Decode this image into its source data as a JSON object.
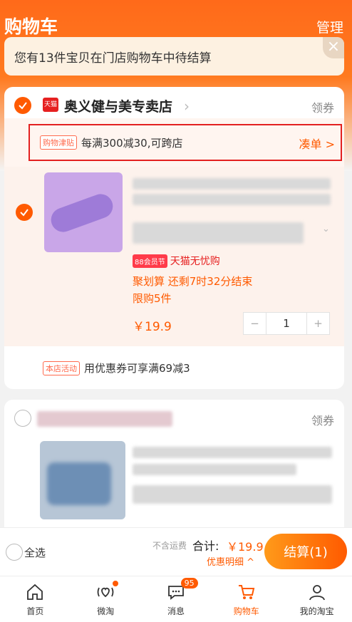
{
  "header": {
    "title": "购物车",
    "manage_label": "管理"
  },
  "notice": {
    "text": "您有13件宝贝在门店购物车中待结算",
    "close_icon": "close-icon"
  },
  "store1": {
    "badge": "天猫",
    "name": "奥义健与美专卖店",
    "coupon_link": "领券",
    "promo_tag": "购物津贴",
    "promo_text": "每满300减30,可跨店",
    "promo_cta": "凑单 >",
    "item": {
      "badge_88": "88会员节",
      "tmall_worry": "天猫无忧购",
      "juhuasuan": "聚划算 还剩7时32分结束",
      "limit": "限购5件",
      "price": "￥19.9",
      "stepper": {
        "minus": "−",
        "quantity": "1",
        "plus": "+"
      }
    },
    "activity_tag": "本店活动",
    "activity_text": "用优惠券可享满69减3"
  },
  "store2": {
    "coupon_link": "领券"
  },
  "checkout": {
    "select_all": "全选",
    "freight_note": "不含运费",
    "total_label": "合计:",
    "total_value": "￥19.9",
    "discount_detail": "优惠明细 ^",
    "checkout_button": "结算(1)"
  },
  "tabbar": {
    "tabs": [
      {
        "label": "首页",
        "icon": "home-icon"
      },
      {
        "label": "微淘",
        "icon": "weitao-icon"
      },
      {
        "label": "消息",
        "icon": "message-icon",
        "badge": "95"
      },
      {
        "label": "购物车",
        "icon": "cart-icon",
        "active": true
      },
      {
        "label": "我的淘宝",
        "icon": "profile-icon"
      }
    ]
  },
  "colors": {
    "accent": "#ff5a00",
    "tmall_red": "#e62020",
    "highlight_border": "#e32020"
  }
}
